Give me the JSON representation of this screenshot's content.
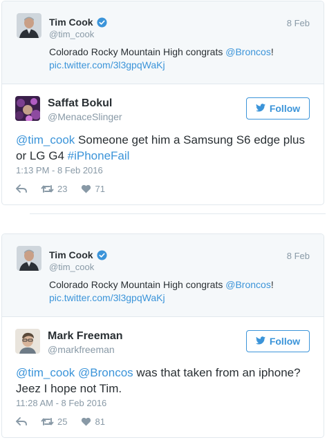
{
  "thread1": {
    "parent": {
      "name": "Tim Cook",
      "handle": "@tim_cook",
      "date": "8 Feb",
      "text_prefix": "Colorado Rocky Mountain High congrats ",
      "mention": "@Broncos",
      "text_suffix": "!",
      "link": "pic.twitter.com/3l3gpqWaKj"
    },
    "reply": {
      "name": "Saffat Bokul",
      "handle": "@MenaceSlinger",
      "follow_label": "Follow",
      "mention": "@tim_cook",
      "text": " Someone get him a Samsung S6 edge plus or LG G4 ",
      "hashtag": "#iPhoneFail",
      "timestamp": "1:13 PM - 8 Feb 2016",
      "retweets": "23",
      "likes": "71"
    }
  },
  "thread2": {
    "parent": {
      "name": "Tim Cook",
      "handle": "@tim_cook",
      "date": "8 Feb",
      "text_prefix": "Colorado Rocky Mountain High congrats ",
      "mention": "@Broncos",
      "text_suffix": "!",
      "link": "pic.twitter.com/3l3gpqWaKj"
    },
    "reply": {
      "name": "Mark Freeman",
      "handle": "@markfreeman",
      "follow_label": "Follow",
      "mention1": "@tim_cook",
      "mention2": "@Broncos",
      "text": " was that taken from an iphone? Jeez I hope not Tim.",
      "timestamp": "11:28 AM - 8 Feb 2016",
      "retweets": "25",
      "likes": "81"
    }
  },
  "colors": {
    "accent": "#3b94d9",
    "muted": "#8899a6",
    "text": "#292f33",
    "parent_bg": "#f5f8fa",
    "border": "#e1e8ed"
  }
}
